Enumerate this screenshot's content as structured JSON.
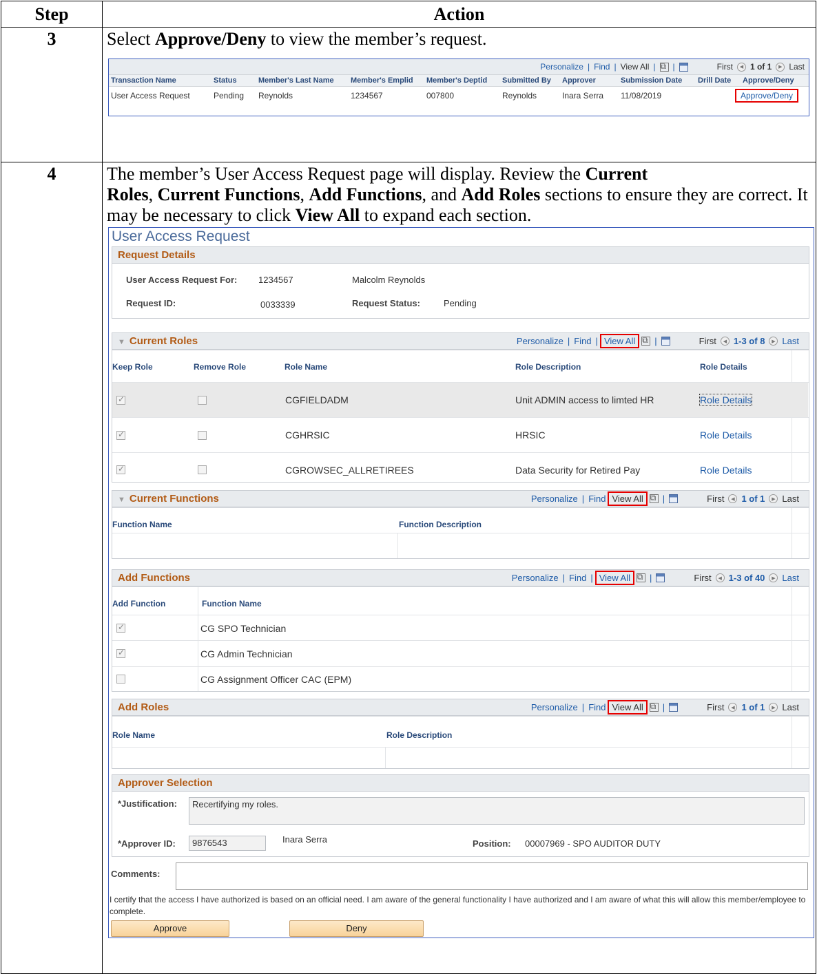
{
  "table": {
    "col_step": "Step",
    "col_action": "Action"
  },
  "step3": {
    "number": "3",
    "text_pre": "Select ",
    "text_bold": "Approve/Deny",
    "text_post": " to view the member’s request.",
    "grid": {
      "nav": {
        "personalize": "Personalize",
        "find": "Find",
        "view_all": "View All",
        "first": "First",
        "range": "1 of 1",
        "last": "Last"
      },
      "columns": [
        "Transaction Name",
        "Status",
        "Member's Last Name",
        "Member's Emplid",
        "Member's Deptid",
        "Submitted By",
        "Approver",
        "Submission Date",
        "Drill Date",
        "Approve/Deny"
      ],
      "row": {
        "transaction": "User Access Request",
        "status": "Pending",
        "last_name": "Reynolds",
        "emplid": "1234567",
        "deptid": "007800",
        "submitted_by": "Reynolds",
        "approver": "Inara Serra",
        "date": "11/08/2019",
        "drill": "",
        "action": "Approve/Deny"
      }
    }
  },
  "step4": {
    "number": "4",
    "p1": "The member’s User Access Request page will display.  Review the ",
    "b1": "Current",
    "b1b": "Roles",
    "p2": ", ",
    "b2": "Current Functions",
    "p3": ", ",
    "b3": "Add Functions",
    "p4": ", and ",
    "b4": "Add Roles",
    "p5": " sections to ensure they are correct.  It may be necessary to click ",
    "b5": "View All",
    "p6": " to expand each section.",
    "page_title": "User Access Request",
    "request_details": {
      "title": "Request Details",
      "for_label": "User Access Request For:",
      "for_id": "1234567",
      "for_name": "Malcolm Reynolds",
      "id_label": "Request ID:",
      "id_value": "0033339",
      "status_label": "Request Status:",
      "status_value": "Pending"
    },
    "current_roles": {
      "title": "Current Roles",
      "nav": {
        "personalize": "Personalize",
        "find": "Find",
        "view_all": "View All",
        "first": "First",
        "range": "1-3 of 8",
        "last": "Last"
      },
      "columns": [
        "Keep Role",
        "Remove Role",
        "Role Name",
        "Role Description",
        "Role Details"
      ],
      "rows": [
        {
          "name": "CGFIELDADM",
          "desc": "Unit ADMIN access to limted HR",
          "details": "Role Details"
        },
        {
          "name": "CGHRSIC",
          "desc": "HRSIC",
          "details": "Role Details"
        },
        {
          "name": "CGROWSEC_ALLRETIREES",
          "desc": "Data Security for Retired Pay",
          "details": "Role Details"
        }
      ]
    },
    "current_functions": {
      "title": "Current Functions",
      "nav": {
        "personalize": "Personalize",
        "find": "Find",
        "view_all": "View All",
        "first": "First",
        "range": "1 of 1",
        "last": "Last"
      },
      "columns": [
        "Function Name",
        "Function Description"
      ]
    },
    "add_functions": {
      "title": "Add Functions",
      "nav": {
        "personalize": "Personalize",
        "find": "Find",
        "view_all": "View All",
        "first": "First",
        "range": "1-3 of 40",
        "last": "Last"
      },
      "columns": [
        "Add Function",
        "Function Name"
      ],
      "rows": [
        {
          "name": "CG SPO Technician",
          "checked": true
        },
        {
          "name": "CG Admin Technician",
          "checked": true
        },
        {
          "name": "CG Assignment Officer CAC (EPM)",
          "checked": false
        }
      ]
    },
    "add_roles": {
      "title": "Add Roles",
      "nav": {
        "personalize": "Personalize",
        "find": "Find",
        "view_all": "View All",
        "first": "First",
        "range": "1 of 1",
        "last": "Last"
      },
      "columns": [
        "Role Name",
        "Role Description"
      ]
    },
    "approver": {
      "title": "Approver Selection",
      "just_label": "*Justification:",
      "just_value": "Recertifying my roles.",
      "id_label": "*Approver ID:",
      "id_value": "9876543",
      "name": "Inara Serra",
      "pos_label": "Position:",
      "pos_value": "00007969 - SPO AUDITOR DUTY"
    },
    "comments_label": "Comments:",
    "certify": "I certify that the access I have authorized is based on an official need. I am aware of the general functionality I have authorized and I am aware of what this will allow this member/employee to complete.",
    "approve_btn": "Approve",
    "deny_btn": "Deny"
  }
}
